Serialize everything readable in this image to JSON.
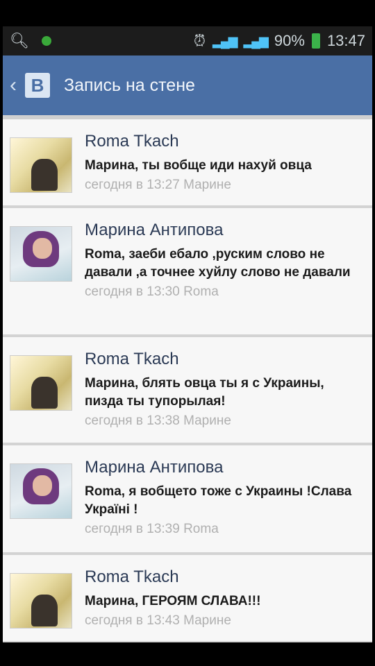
{
  "status_bar": {
    "battery": "90%",
    "time": "13:47"
  },
  "header": {
    "logo": "B",
    "title": "Запись на стене"
  },
  "comments": [
    {
      "author": "Roma Tkach",
      "text": "Марина, ты вобще иди нахуй овца",
      "meta": "сегодня в 13:27 Марине",
      "avatar": "roma"
    },
    {
      "author": "Марина Антипова",
      "text": "Roma, заеби ебало ,руским слово не давали ,а точнее хуйлу слово не давали",
      "meta": "сегодня в 13:30 Roma",
      "avatar": "marina"
    },
    {
      "author": "Roma Tkach",
      "text": "Марина, блять овца ты я с Украины, пизда ты тупорылая!",
      "meta": "сегодня в 13:38 Марине",
      "avatar": "roma"
    },
    {
      "author": "Марина Антипова",
      "text": "Roma, я вобщето тоже с Украины !Слава Україні !",
      "meta": "сегодня в 13:39 Roma",
      "avatar": "marina"
    },
    {
      "author": "Roma Tkach",
      "text": "Марина, ГЕРОЯМ СЛАВА!!!",
      "meta": "сегодня в 13:43 Марине",
      "avatar": "roma"
    }
  ]
}
